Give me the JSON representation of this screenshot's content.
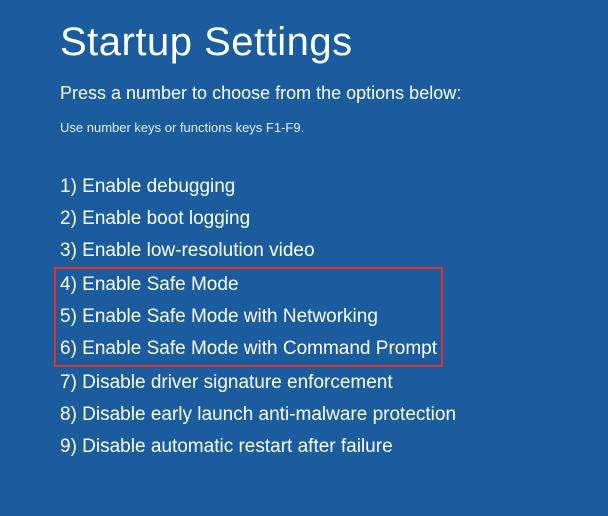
{
  "title": "Startup Settings",
  "subtitle": "Press a number to choose from the options below:",
  "hint": "Use number keys or functions keys F1-F9.",
  "options": [
    "1) Enable debugging",
    "2) Enable boot logging",
    "3) Enable low-resolution video",
    "4) Enable Safe Mode",
    "5) Enable Safe Mode with Networking",
    "6) Enable Safe Mode with Command Prompt",
    "7) Disable driver signature enforcement",
    "8) Disable early launch anti-malware protection",
    "9) Disable automatic restart after failure"
  ],
  "highlight_range": {
    "start": 3,
    "end": 5
  },
  "colors": {
    "background": "#1b5c9e",
    "text": "#ffffff",
    "highlight_border": "#e53030"
  }
}
